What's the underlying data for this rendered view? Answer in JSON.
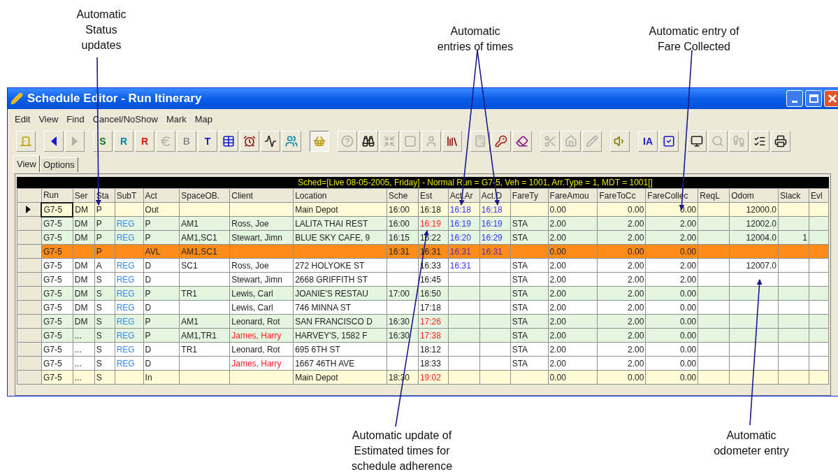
{
  "window": {
    "title": "Schedule Editor - Run Itinerary"
  },
  "menu": [
    "Edit",
    "View",
    "Find",
    "Cancel/NoShow",
    "Mark",
    "Map"
  ],
  "toolbar": [
    [
      {
        "kind": "door",
        "disabled": false,
        "pressed": false
      }
    ],
    [
      {
        "kind": "left",
        "disabled": false,
        "pressed": false
      },
      {
        "kind": "right",
        "disabled": true,
        "pressed": false
      }
    ],
    [
      {
        "kind": "letter",
        "label": "S",
        "color": "#0a7a1a",
        "disabled": false,
        "pressed": false
      },
      {
        "kind": "letter",
        "label": "R",
        "color": "#0088aa",
        "disabled": false,
        "pressed": false
      },
      {
        "kind": "letter",
        "label": "R",
        "color": "#e01818",
        "disabled": false,
        "pressed": false
      },
      {
        "kind": "euro",
        "disabled": true,
        "pressed": false
      },
      {
        "kind": "letter",
        "label": "B",
        "color": "#8c8c86",
        "disabled": true,
        "pressed": false
      },
      {
        "kind": "letter",
        "label": "T",
        "color": "#1a1acc",
        "disabled": false,
        "pressed": false
      },
      {
        "kind": "table",
        "disabled": false,
        "pressed": false
      },
      {
        "kind": "clock",
        "disabled": false,
        "pressed": false
      },
      {
        "kind": "chart",
        "disabled": false,
        "pressed": false
      },
      {
        "kind": "people",
        "disabled": false,
        "pressed": false
      }
    ],
    [
      {
        "kind": "basket",
        "disabled": false,
        "pressed": true
      }
    ],
    [
      {
        "kind": "help",
        "disabled": true,
        "pressed": false
      },
      {
        "kind": "binoculars",
        "disabled": false,
        "pressed": false
      },
      {
        "kind": "shrink",
        "disabled": true,
        "pressed": false
      },
      {
        "kind": "square",
        "disabled": true,
        "pressed": false
      },
      {
        "kind": "person",
        "disabled": true,
        "pressed": false
      },
      {
        "kind": "books",
        "disabled": false,
        "pressed": false
      }
    ],
    [
      {
        "kind": "calculator",
        "disabled": true,
        "pressed": false
      },
      {
        "kind": "key",
        "disabled": false,
        "pressed": false
      },
      {
        "kind": "eraser",
        "disabled": false,
        "pressed": false
      }
    ],
    [
      {
        "kind": "scissors",
        "disabled": true,
        "pressed": false
      },
      {
        "kind": "house",
        "disabled": true,
        "pressed": false
      },
      {
        "kind": "pencil",
        "disabled": true,
        "pressed": false
      }
    ],
    [
      {
        "kind": "speaker",
        "disabled": false,
        "pressed": false
      }
    ],
    [
      {
        "kind": "letter",
        "label": "IA",
        "color": "#1a1acc",
        "disabled": false,
        "pressed": false
      },
      {
        "kind": "check",
        "disabled": false,
        "pressed": false
      }
    ],
    [
      {
        "kind": "monitor",
        "disabled": false,
        "pressed": false
      },
      {
        "kind": "search",
        "disabled": true,
        "pressed": false
      },
      {
        "kind": "footprints",
        "disabled": true,
        "pressed": false
      },
      {
        "kind": "list",
        "disabled": false,
        "pressed": false
      },
      {
        "kind": "printer",
        "disabled": false,
        "pressed": false
      }
    ]
  ],
  "tabs": [
    {
      "label": "View",
      "selected": true
    },
    {
      "label": "Options",
      "selected": false
    }
  ],
  "grid": {
    "banner": "Sched=[Live 08-05-2005, Friday] - Normal Run = G7-5, Veh = 1001, Arr.Type = 1, MDT = 1001[]",
    "columns": [
      "Run",
      "Ser",
      "Sta",
      "SubT",
      "Act",
      "SpaceOB.",
      "Client",
      "Location",
      "Sche",
      "Est",
      "Act.Ar",
      "Act.D",
      "FareTy",
      "FareAmou",
      "FareToCc",
      "FareCollec",
      "ReqL",
      "Odom",
      "Slack",
      "Evl"
    ],
    "rows": [
      {
        "kind": "depot",
        "selected": true,
        "est_late": false,
        "run": "G7-5",
        "service": "DM",
        "status": "P",
        "action": "Out",
        "location": "Main Depot",
        "scheduled": "16:00",
        "estimated": "16:18",
        "actual_arrive": "16:18",
        "actual_depart": "16:18",
        "fare_amount": "0.00",
        "fare_to_collect": "0.00",
        "fare_collected": "0.00",
        "odometer": "12000.0"
      },
      {
        "kind": "pickup",
        "selected": false,
        "est_late": true,
        "client_alert": false,
        "run": "G7-5",
        "service": "DM",
        "status": "P",
        "subtype": "REG",
        "action": "P",
        "space": "AM1",
        "client": "Ross, Joe",
        "location": "LALITA THAI REST",
        "scheduled": "16:00",
        "estimated": "16:19",
        "actual_arrive": "16:19",
        "actual_depart": "16:19",
        "fare_type": "STA",
        "fare_amount": "2.00",
        "fare_to_collect": "2.00",
        "fare_collected": "2.00",
        "odometer": "12002.0"
      },
      {
        "kind": "pickup",
        "selected": false,
        "est_late": false,
        "client_alert": false,
        "run": "G7-5",
        "service": "DM",
        "status": "P",
        "subtype": "REG",
        "action": "P",
        "space": "AM1,SC1",
        "client": "Stewart, Jimn",
        "location": "BLUE SKY CAFE, 9",
        "scheduled": "16:15",
        "estimated": "16:22",
        "actual_arrive": "16:20",
        "actual_depart": "16:29",
        "fare_type": "STA",
        "fare_amount": "2.00",
        "fare_to_collect": "2.00",
        "fare_collected": "2.00",
        "odometer": "12004.0",
        "slack": "1"
      },
      {
        "kind": "avl",
        "selected": false,
        "est_late": false,
        "run": "G7-5",
        "status": "P",
        "action": "AVL",
        "space": "AM1,SC1",
        "scheduled": "16:31",
        "estimated": "16:31",
        "actual_arrive": "16:31",
        "actual_depart": "16:31",
        "fare_amount": "0.00",
        "fare_to_collect": "0.00",
        "fare_collected": "0.00"
      },
      {
        "kind": "dropoff",
        "selected": false,
        "est_late": false,
        "client_alert": false,
        "run": "G7-5",
        "service": "DM",
        "status": "A",
        "subtype": "REG",
        "action": "D",
        "space": "SC1",
        "client": "Ross, Joe",
        "location": "272 HOLYOKE ST",
        "estimated": "16:33",
        "actual_arrive": "16:31",
        "fare_type": "STA",
        "fare_amount": "2.00",
        "fare_to_collect": "2.00",
        "fare_collected": "2.00",
        "odometer": "12007.0"
      },
      {
        "kind": "dropoff",
        "selected": false,
        "est_late": false,
        "client_alert": false,
        "run": "G7-5",
        "service": "DM",
        "status": "S",
        "subtype": "REG",
        "action": "D",
        "client": "Stewart, Jimn",
        "location": "2668 GRIFFITH ST",
        "estimated": "16:45",
        "fare_type": "STA",
        "fare_amount": "2.00",
        "fare_to_collect": "2.00",
        "fare_collected": "2.00"
      },
      {
        "kind": "pickup",
        "selected": false,
        "est_late": false,
        "client_alert": false,
        "run": "G7-5",
        "service": "DM",
        "status": "S",
        "subtype": "REG",
        "action": "P",
        "space": "TR1",
        "client": "Lewis, Carl",
        "location": "JOANIE'S RESTAU",
        "scheduled": "17:00",
        "estimated": "16:50",
        "fare_type": "STA",
        "fare_amount": "2.00",
        "fare_to_collect": "2.00",
        "fare_collected": "0.00"
      },
      {
        "kind": "dropoff",
        "selected": false,
        "est_late": false,
        "client_alert": false,
        "run": "G7-5",
        "service": "DM",
        "status": "S",
        "subtype": "REG",
        "action": "D",
        "client": "Lewis, Carl",
        "location": "746 MINNA ST",
        "estimated": "17:18",
        "fare_type": "STA",
        "fare_amount": "2.00",
        "fare_to_collect": "2.00",
        "fare_collected": "0.00"
      },
      {
        "kind": "pickup",
        "selected": false,
        "est_late": true,
        "client_alert": false,
        "run": "G7-5",
        "service": "DM",
        "status": "S",
        "subtype": "REG",
        "action": "P",
        "space": "AM1",
        "client": "Leonard, Rot",
        "location": "SAN FRANCISCO D",
        "scheduled": "16:30",
        "estimated": "17:26",
        "fare_type": "STA",
        "fare_amount": "2.00",
        "fare_to_collect": "2.00",
        "fare_collected": "0.00"
      },
      {
        "kind": "pickup",
        "selected": false,
        "est_late": true,
        "client_alert": true,
        "run": "G7-5",
        "service": "...",
        "status": "S",
        "subtype": "REG",
        "action": "P",
        "space": "AM1,TR1",
        "client": "James, Harry",
        "location": "HARVEY'S, 1582 F",
        "scheduled": "16:30",
        "estimated": "17:38",
        "fare_type": "STA",
        "fare_amount": "2.00",
        "fare_to_collect": "2.00",
        "fare_collected": "0.00"
      },
      {
        "kind": "dropoff",
        "selected": false,
        "est_late": false,
        "client_alert": false,
        "run": "G7-5",
        "service": "...",
        "status": "S",
        "subtype": "REG",
        "action": "D",
        "space": "TR1",
        "client": "Leonard, Rot",
        "location": "695 6TH ST",
        "estimated": "18:12",
        "fare_type": "STA",
        "fare_amount": "2.00",
        "fare_to_collect": "2.00",
        "fare_collected": "0.00"
      },
      {
        "kind": "dropoff",
        "selected": false,
        "est_late": false,
        "client_alert": true,
        "run": "G7-5",
        "service": "...",
        "status": "S",
        "subtype": "REG",
        "action": "D",
        "client": "James, Harry",
        "location": "1667 46TH AVE",
        "estimated": "18:33",
        "fare_type": "STA",
        "fare_amount": "2.00",
        "fare_to_collect": "2.00",
        "fare_collected": "0.00"
      },
      {
        "kind": "depot",
        "selected": false,
        "est_late": true,
        "run": "G7-5",
        "service": "...",
        "status": "S",
        "action": "In",
        "location": "Main Depot",
        "scheduled": "18:30",
        "estimated": "19:02",
        "fare_amount": "0.00",
        "fare_to_collect": "0.00",
        "fare_collected": "0.00"
      }
    ]
  },
  "annotations": [
    {
      "lines": [
        "Automatic",
        "Status",
        "updates"
      ]
    },
    {
      "lines": [
        "Automatic",
        "entries of times"
      ]
    },
    {
      "lines": [
        "Automatic entry of",
        "Fare Collected"
      ]
    },
    {
      "lines": [
        "Automatic update of",
        "Estimated times for",
        "schedule adherence"
      ]
    },
    {
      "lines": [
        "Automatic",
        "odometer entry"
      ]
    }
  ]
}
